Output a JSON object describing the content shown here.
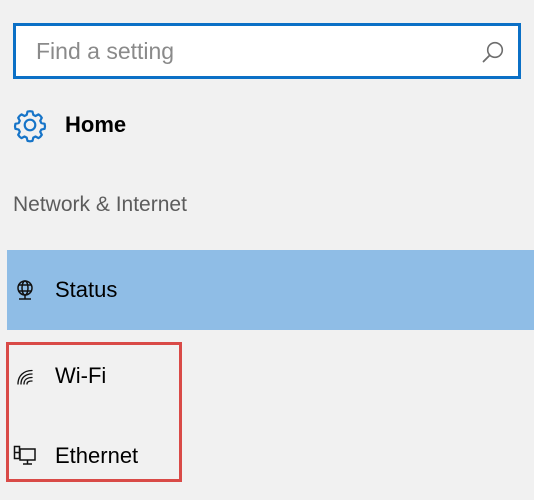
{
  "search": {
    "placeholder": "Find a setting",
    "value": ""
  },
  "home": {
    "label": "Home",
    "icon": "gear-icon"
  },
  "section": {
    "title": "Network & Internet"
  },
  "nav": {
    "items": [
      {
        "label": "Status",
        "icon": "globe-icon",
        "selected": true
      },
      {
        "label": "Wi-Fi",
        "icon": "wifi-icon",
        "selected": false
      },
      {
        "label": "Ethernet",
        "icon": "ethernet-icon",
        "selected": false
      }
    ]
  },
  "colors": {
    "search_border": "#0b70c6",
    "selected_background": "#8fbde6",
    "highlight_border": "#d94a47",
    "page_background": "#f1f1f1"
  }
}
